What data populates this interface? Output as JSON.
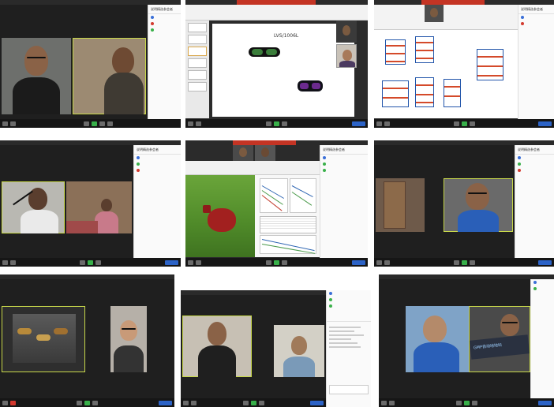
{
  "screenshots": [
    {
      "id": "s1",
      "chat_title": "说明精选参会者",
      "chat_items": [
        {
          "label": "",
          "color": "#3a6fd8"
        },
        {
          "label": "",
          "color": "#d33b2f"
        },
        {
          "label": "",
          "color": "#3ab04a"
        }
      ],
      "video_labels": [
        "",
        ""
      ],
      "end_label": ""
    },
    {
      "id": "s2",
      "window_title": "",
      "slide_title": "LVS/1006L",
      "slide_lines": [
        "",
        "",
        "",
        "",
        "",
        "",
        "",
        "",
        "",
        "",
        ""
      ],
      "slide_caption": "",
      "end_label": ""
    },
    {
      "id": "s3",
      "chat_title": "说明精选参会者",
      "chat_items": [
        {
          "label": "",
          "color": "#3a6fd8"
        },
        {
          "label": "",
          "color": "#d33b2f"
        }
      ],
      "end_label": ""
    },
    {
      "id": "s4",
      "chat_title": "说明精选参会者",
      "chat_items": [
        {
          "label": "",
          "color": "#3a6fd8"
        },
        {
          "label": "",
          "color": "#3ab04a"
        },
        {
          "label": "",
          "color": "#d33b2f"
        }
      ],
      "end_label": ""
    },
    {
      "id": "s5",
      "chat_title": "说明精选参会者",
      "chat_items": [
        {
          "label": "",
          "color": "#3a6fd8"
        },
        {
          "label": "",
          "color": "#3ab04a"
        },
        {
          "label": "",
          "color": "#3ab04a"
        }
      ],
      "end_label": ""
    },
    {
      "id": "s6",
      "chat_title": "说明精选参会者",
      "chat_items": [
        {
          "label": "",
          "color": "#3a6fd8"
        },
        {
          "label": "",
          "color": "#3ab04a"
        },
        {
          "label": "",
          "color": "#d33b2f"
        }
      ],
      "video_labels": [
        "",
        ""
      ],
      "end_label": ""
    },
    {
      "id": "s7",
      "video_labels": [
        "",
        ""
      ],
      "end_label": ""
    },
    {
      "id": "s8",
      "chat_title": "",
      "chat_items": [
        {
          "label": "",
          "color": "#3a6fd8"
        },
        {
          "label": "",
          "color": "#3ab04a"
        },
        {
          "label": "",
          "color": "#3ab04a"
        }
      ],
      "end_label": ""
    },
    {
      "id": "s9",
      "chat_title": "",
      "chat_items": [
        {
          "label": "",
          "color": "#3a6fd8"
        },
        {
          "label": "",
          "color": "#3ab04a"
        }
      ],
      "shared_banner": "GMP自动地地坛",
      "end_label": ""
    }
  ]
}
